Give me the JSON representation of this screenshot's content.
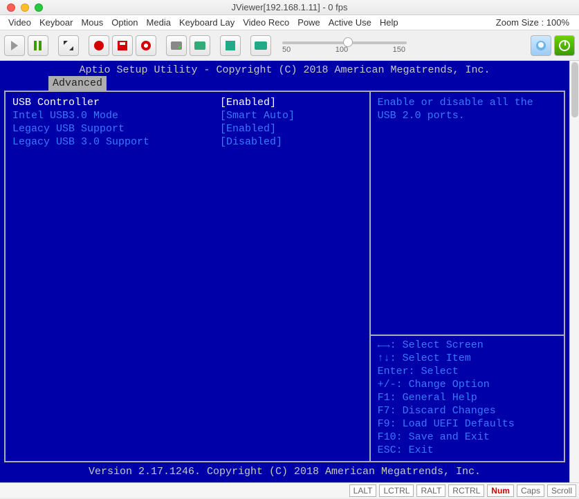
{
  "window": {
    "title": "JViewer[192.168.1.11] - 0 fps"
  },
  "menubar": {
    "items": [
      "Video",
      "Keyboar",
      "Mous",
      "Option",
      "Media",
      "Keyboard Lay",
      "Video Reco",
      "Powe",
      "Active Use",
      "Help"
    ],
    "zoom_label": "Zoom Size : 100%"
  },
  "toolbar": {
    "slider": {
      "min": 50,
      "mid": 100,
      "max": 150,
      "value": 100
    }
  },
  "bios": {
    "header": "Aptio Setup Utility - Copyright (C) 2018 American Megatrends, Inc.",
    "active_tab": "Advanced",
    "settings": [
      {
        "label": "USB Controller",
        "value": "[Enabled]",
        "selected": true
      },
      {
        "label": "Intel USB3.0 Mode",
        "value": "[Smart Auto]",
        "selected": false
      },
      {
        "label": "Legacy USB Support",
        "value": "[Enabled]",
        "selected": false
      },
      {
        "label": "Legacy USB 3.0 Support",
        "value": "[Disabled]",
        "selected": false
      }
    ],
    "help_text": "Enable or disable all the USB 2.0 ports.",
    "keyhelp": {
      "select_screen": "←→: Select Screen",
      "select_item": "↑↓: Select Item",
      "enter": "Enter: Select",
      "change": "+/-: Change Option",
      "f1": "F1: General Help",
      "f7": "F7: Discard Changes",
      "f9": "F9: Load UEFI Defaults",
      "f10": "F10: Save and Exit",
      "esc": "ESC: Exit"
    },
    "footer": "Version 2.17.1246. Copyright (C) 2018 American Megatrends, Inc."
  },
  "statusbar": {
    "keys": [
      {
        "label": "LALT",
        "active": false
      },
      {
        "label": "LCTRL",
        "active": false
      },
      {
        "label": "RALT",
        "active": false
      },
      {
        "label": "RCTRL",
        "active": false
      },
      {
        "label": "Num",
        "active": true
      },
      {
        "label": "Caps",
        "active": false
      },
      {
        "label": "Scroll",
        "active": false
      }
    ]
  }
}
